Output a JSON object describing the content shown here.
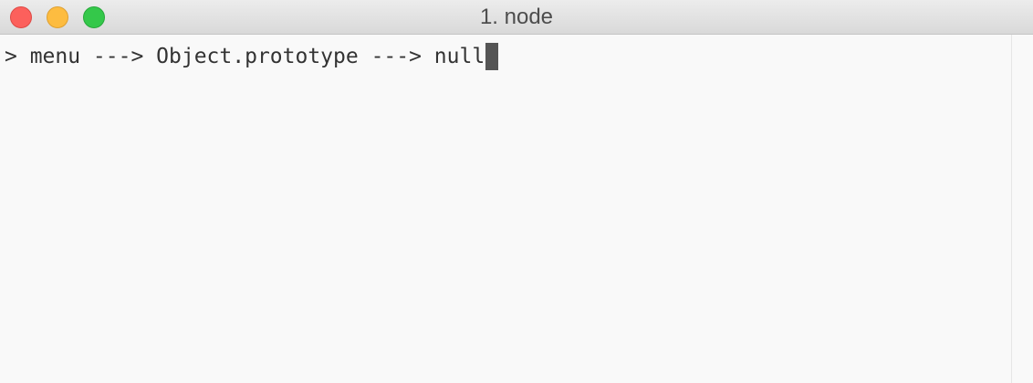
{
  "window": {
    "title": "1. node"
  },
  "terminal": {
    "line_text": "> menu ---> Object.prototype ---> null"
  },
  "colors": {
    "close": "#fc605c",
    "minimize": "#fdbc40",
    "zoom": "#34c84a",
    "background": "#f9f9f9",
    "text": "#333333",
    "cursor": "#555555"
  }
}
